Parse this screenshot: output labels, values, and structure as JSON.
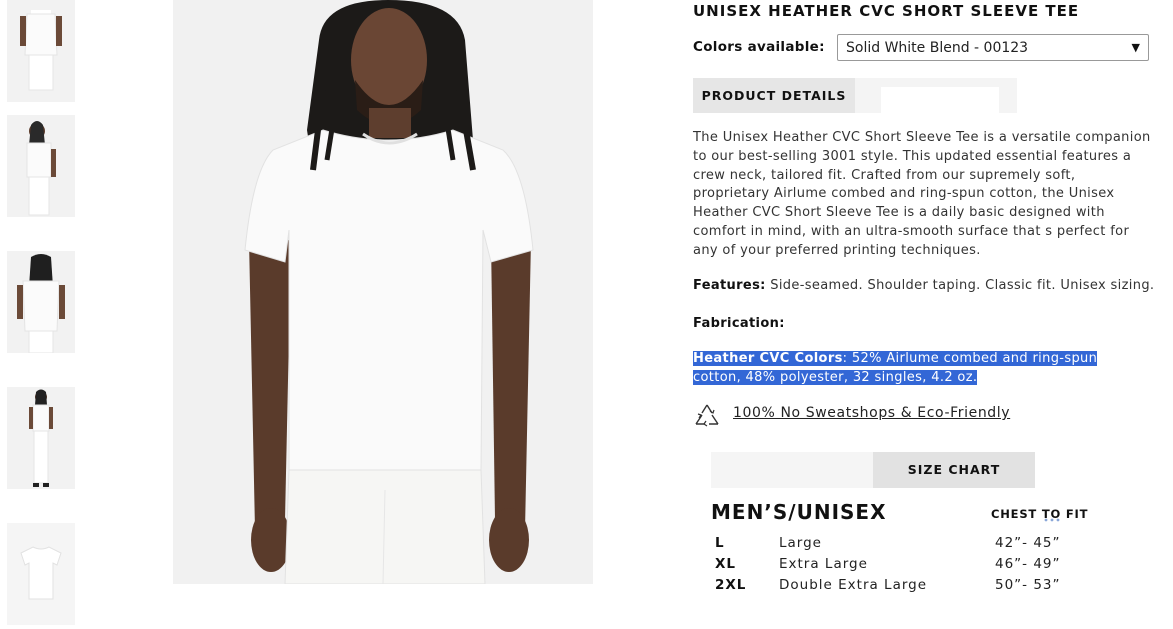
{
  "product": {
    "title": "UNISEX HEATHER CVC SHORT SLEEVE TEE",
    "colors_label": "Colors available:",
    "selected_color": "Solid White Blend - 00123",
    "tab_details": "PRODUCT DETAILS",
    "description": "The Unisex Heather CVC Short Sleeve Tee is a versatile companion to our best-selling 3001 style. This updated essential features a crew neck, tailored fit. Crafted from our supremely soft, proprietary Airlume combed and ring-spun cotton, the Unisex Heather CVC Short Sleeve Tee is a daily basic designed with comfort in mind, with an ultra-smooth surface that s perfect for any of your preferred printing techniques.",
    "features_label": "Features:",
    "features_text": " Side-seamed. Shoulder taping. Classic fit. Unisex sizing.",
    "fabrication_label": "Fabrication:",
    "heather_label": "Heather CVC Colors",
    "heather_text": ": 52% Airlume combed and ring-spun cotton, 48% polyester, 32 singles, 4.2 oz.",
    "eco_text": "100% No Sweatshops & Eco-Friendly"
  },
  "size_chart": {
    "tab_label": "SIZE CHART",
    "heading": "MEN’S/UNISEX",
    "chest_label": "CHEST TO FIT",
    "rows": [
      {
        "code": "L",
        "name": "Large",
        "chest": "42”- 45”"
      },
      {
        "code": "XL",
        "name": "Extra Large",
        "chest": "46”- 49”"
      },
      {
        "code": "2XL",
        "name": "Double Extra Large",
        "chest": "50”- 53”"
      }
    ]
  },
  "colors": {
    "highlight": "#3367d6",
    "tab_active": "#e6e6e6"
  }
}
